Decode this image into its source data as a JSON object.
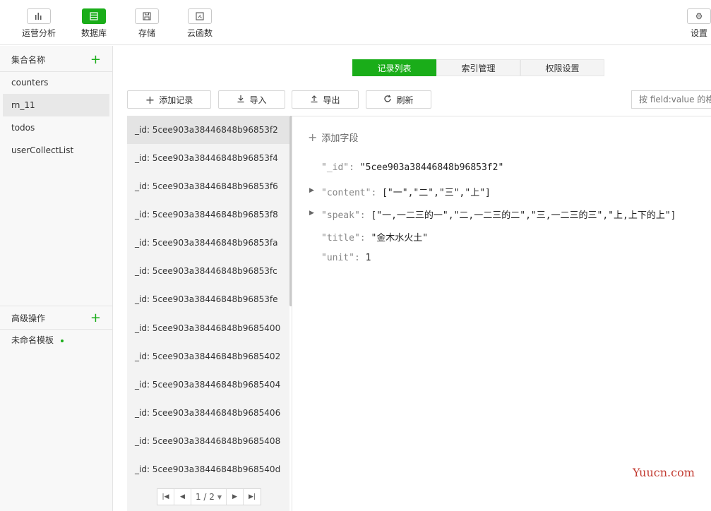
{
  "toolbar": {
    "items": [
      {
        "label": "运营分析",
        "icon": "bar-chart-icon"
      },
      {
        "label": "数据库",
        "icon": "database-icon"
      },
      {
        "label": "存储",
        "icon": "floppy-disk-icon"
      },
      {
        "label": "云函数",
        "icon": "function-icon"
      }
    ],
    "settings": {
      "label": "设置",
      "icon": "gear-icon"
    }
  },
  "sidebar": {
    "collections_header": "集合名称",
    "collections": [
      "counters",
      "rn_11",
      "todos",
      "userCollectList"
    ],
    "advanced_header": "高级操作",
    "templates": [
      "未命名模板"
    ]
  },
  "tabs": [
    "记录列表",
    "索引管理",
    "权限设置"
  ],
  "actions": {
    "add_record": "添加记录",
    "import": "导入",
    "export": "导出",
    "refresh": "刷新"
  },
  "search": {
    "placeholder": "按 field:value 的格式查找"
  },
  "records": [
    "_id: 5cee903a38446848b96853f2",
    "_id: 5cee903a38446848b96853f4",
    "_id: 5cee903a38446848b96853f6",
    "_id: 5cee903a38446848b96853f8",
    "_id: 5cee903a38446848b96853fa",
    "_id: 5cee903a38446848b96853fc",
    "_id: 5cee903a38446848b96853fe",
    "_id: 5cee903a38446848b9685400",
    "_id: 5cee903a38446848b9685402",
    "_id: 5cee903a38446848b9685404",
    "_id: 5cee903a38446848b9685406",
    "_id: 5cee903a38446848b9685408",
    "_id: 5cee903a38446848b968540d"
  ],
  "pagination": {
    "page": "1 / 2"
  },
  "document": {
    "add_field": "添加字段",
    "fields": [
      {
        "key": "\"_id\":",
        "value": "\"5cee903a38446848b96853f2\""
      },
      {
        "key": "\"content\":",
        "value": "[\"一\",\"二\",\"三\",\"上\"]"
      },
      {
        "key": "\"speak\":",
        "value": "[\"一,一二三的一\",\"二,一二三的二\",\"三,一二三的三\",\"上,上下的上\"]"
      },
      {
        "key": "\"title\":",
        "value": "\"金木水火土\""
      },
      {
        "key": "\"unit\":",
        "value": "1"
      }
    ]
  },
  "watermark": "Yuucn.com",
  "colors": {
    "accent": "#1aad19",
    "watermark": "#c23a30"
  }
}
